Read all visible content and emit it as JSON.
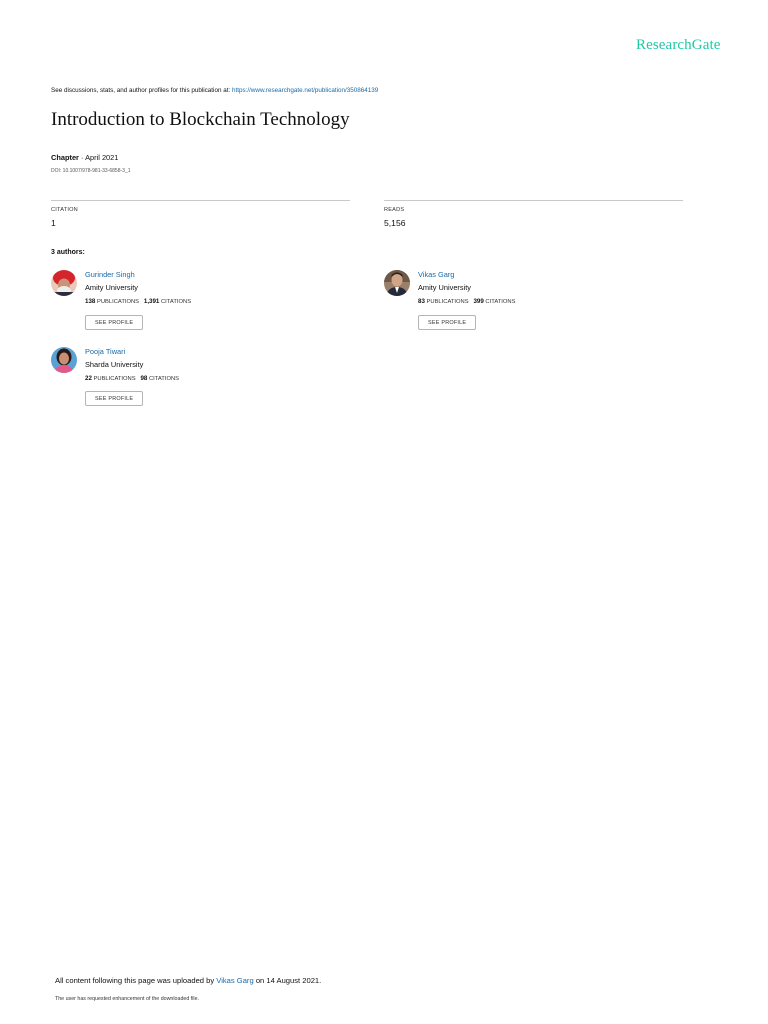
{
  "brand": "ResearchGate",
  "discussion": {
    "text": "See discussions, stats, and author profiles for this publication at: ",
    "link": "https://www.researchgate.net/publication/350864139"
  },
  "title": "Introduction to Blockchain Technology",
  "meta": {
    "type": "Chapter",
    "separator": " · ",
    "date": "April 2021",
    "doi": "DOI: 10.1007/978-981-33-6858-3_1"
  },
  "stats": {
    "citation_label": "CITATION",
    "citation_value": "1",
    "reads_label": "READS",
    "reads_value": "5,156"
  },
  "authors_heading": "3 authors:",
  "authors": [
    {
      "name": "Gurinder Singh",
      "institution": "Amity University",
      "publications": "138",
      "publications_label": "PUBLICATIONS",
      "citations": "1,391",
      "citations_label": "CITATIONS",
      "button": "SEE PROFILE"
    },
    {
      "name": "Vikas Garg",
      "institution": "Amity University",
      "publications": "83",
      "publications_label": "PUBLICATIONS",
      "citations": "399",
      "citations_label": "CITATIONS",
      "button": "SEE PROFILE"
    },
    {
      "name": "Pooja Tiwari",
      "institution": "Sharda University",
      "publications": "22",
      "publications_label": "PUBLICATIONS",
      "citations": "98",
      "citations_label": "CITATIONS",
      "button": "SEE PROFILE"
    }
  ],
  "footer": {
    "upload_prefix": "All content following this page was uploaded by ",
    "uploader": "Vikas Garg",
    "upload_suffix": " on 14 August 2021.",
    "note": "The user has requested enhancement of the downloaded file."
  }
}
